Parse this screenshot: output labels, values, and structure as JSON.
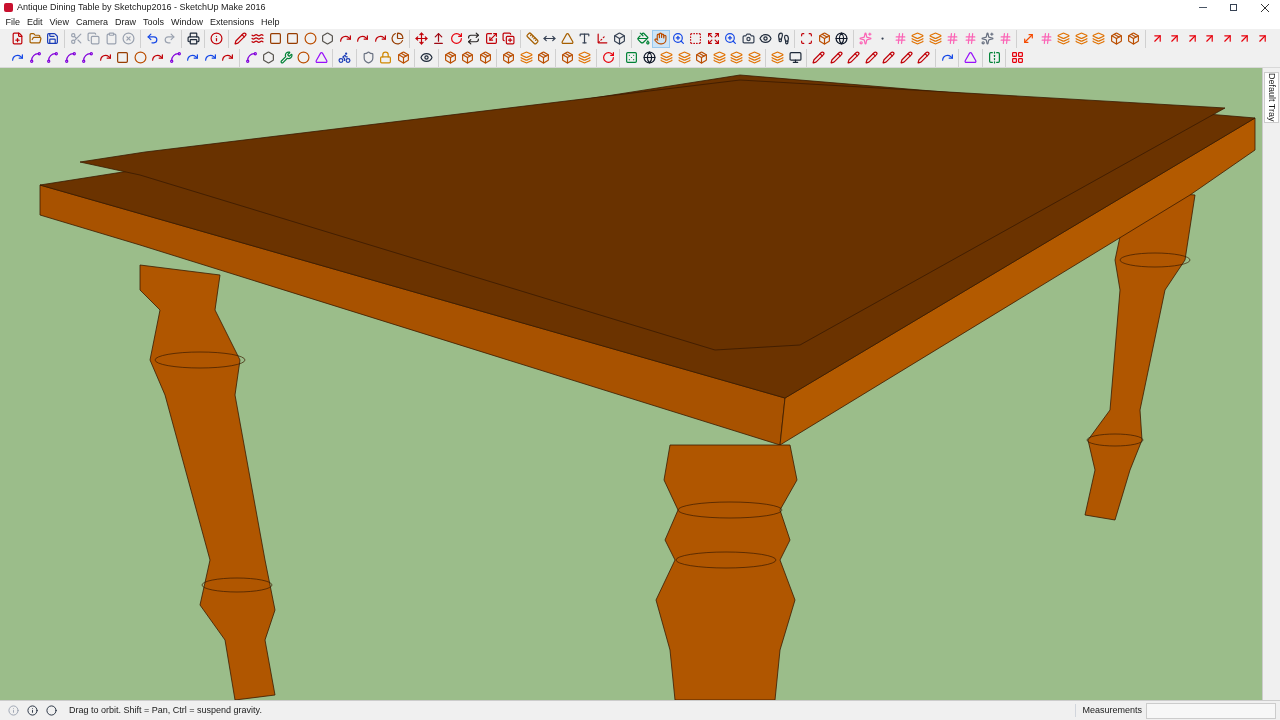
{
  "window": {
    "title": "Antique Dining Table by Sketchup2016 - SketchUp Make 2016"
  },
  "menu": [
    "File",
    "Edit",
    "View",
    "Camera",
    "Draw",
    "Tools",
    "Window",
    "Extensions",
    "Help"
  ],
  "toolbar_rows": [
    {
      "groups": [
        [
          {
            "kind": "new",
            "selected": false
          },
          {
            "kind": "open",
            "selected": false
          },
          {
            "kind": "save",
            "selected": false
          }
        ],
        [
          {
            "kind": "cut",
            "selected": false
          },
          {
            "kind": "copy",
            "selected": false
          },
          {
            "kind": "paste",
            "selected": false
          },
          {
            "kind": "erase",
            "selected": false
          }
        ],
        [
          {
            "kind": "undo",
            "selected": false
          },
          {
            "kind": "redo",
            "selected": false
          }
        ],
        [
          {
            "kind": "print",
            "selected": false
          }
        ],
        [
          {
            "kind": "info",
            "selected": false
          }
        ],
        [
          {
            "kind": "pencil",
            "selected": false
          },
          {
            "kind": "freehand",
            "selected": false
          },
          {
            "kind": "rectangle",
            "selected": false
          },
          {
            "kind": "rectangle",
            "selected": false
          },
          {
            "kind": "circle",
            "selected": false
          },
          {
            "kind": "polygon",
            "selected": false
          },
          {
            "kind": "arc",
            "selected": false
          },
          {
            "kind": "arc",
            "selected": false
          },
          {
            "kind": "arc",
            "selected": false
          },
          {
            "kind": "pie",
            "selected": false
          }
        ],
        [
          {
            "kind": "move",
            "selected": false
          },
          {
            "kind": "pushpull",
            "selected": false
          },
          {
            "kind": "rotate",
            "selected": false
          },
          {
            "kind": "followme",
            "selected": false
          },
          {
            "kind": "scale",
            "selected": false
          },
          {
            "kind": "offset",
            "selected": false
          }
        ],
        [
          {
            "kind": "tape",
            "selected": false
          },
          {
            "kind": "dimension",
            "selected": false
          },
          {
            "kind": "protractor",
            "selected": false
          },
          {
            "kind": "text",
            "selected": false
          },
          {
            "kind": "axes",
            "selected": false
          },
          {
            "kind": "text3d",
            "selected": false
          }
        ],
        [
          {
            "kind": "paint",
            "selected": false
          },
          {
            "kind": "orbit",
            "selected": true
          },
          {
            "kind": "zoom",
            "selected": false
          },
          {
            "kind": "zoomwindow",
            "selected": false
          },
          {
            "kind": "extents",
            "selected": false
          },
          {
            "kind": "zoom",
            "selected": false
          },
          {
            "kind": "camera",
            "selected": false
          },
          {
            "kind": "eye",
            "selected": false
          },
          {
            "kind": "walk",
            "selected": false
          }
        ],
        [
          {
            "kind": "section",
            "selected": false
          },
          {
            "kind": "component",
            "selected": false
          },
          {
            "kind": "sphere",
            "selected": false
          }
        ],
        [
          {
            "kind": "point",
            "selected": false
          },
          {
            "kind": "dot",
            "selected": false
          },
          {
            "kind": "grid",
            "selected": false
          },
          {
            "kind": "layer",
            "selected": false
          },
          {
            "kind": "layer",
            "selected": false
          },
          {
            "kind": "grid",
            "selected": false
          },
          {
            "kind": "grid",
            "selected": false
          },
          {
            "kind": "star",
            "selected": false
          },
          {
            "kind": "grid",
            "selected": false
          }
        ],
        [
          {
            "kind": "guide",
            "selected": false
          },
          {
            "kind": "grid",
            "selected": false
          },
          {
            "kind": "layer",
            "selected": false
          },
          {
            "kind": "layer",
            "selected": false
          },
          {
            "kind": "layer",
            "selected": false
          },
          {
            "kind": "component",
            "selected": false
          },
          {
            "kind": "component",
            "selected": false
          }
        ],
        [
          {
            "kind": "export",
            "selected": false
          },
          {
            "kind": "export",
            "selected": false
          },
          {
            "kind": "export",
            "selected": false
          },
          {
            "kind": "export",
            "selected": false
          },
          {
            "kind": "export",
            "selected": false
          },
          {
            "kind": "export",
            "selected": false
          },
          {
            "kind": "export",
            "selected": false
          }
        ]
      ]
    },
    {
      "groups": [
        [
          {
            "kind": "curve",
            "selected": false
          },
          {
            "kind": "spline",
            "selected": false
          },
          {
            "kind": "spline",
            "selected": false
          },
          {
            "kind": "spline",
            "selected": false
          },
          {
            "kind": "spline",
            "selected": false
          },
          {
            "kind": "arc",
            "selected": false
          },
          {
            "kind": "rectangle",
            "selected": false
          },
          {
            "kind": "circle",
            "selected": false
          },
          {
            "kind": "arc",
            "selected": false
          },
          {
            "kind": "spline",
            "selected": false
          },
          {
            "kind": "curve",
            "selected": false
          },
          {
            "kind": "curve",
            "selected": false
          },
          {
            "kind": "arc",
            "selected": false
          }
        ],
        [
          {
            "kind": "spline",
            "selected": false
          },
          {
            "kind": "polygon",
            "selected": false
          },
          {
            "kind": "wrench",
            "selected": false
          },
          {
            "kind": "circle",
            "selected": false
          },
          {
            "kind": "triangle",
            "selected": false
          }
        ],
        [
          {
            "kind": "bike",
            "selected": false
          }
        ],
        [
          {
            "kind": "shield",
            "selected": false
          },
          {
            "kind": "lock",
            "selected": false
          },
          {
            "kind": "component",
            "selected": false
          }
        ],
        [
          {
            "kind": "eye",
            "selected": false
          }
        ],
        [
          {
            "kind": "component",
            "selected": false
          },
          {
            "kind": "component",
            "selected": false
          },
          {
            "kind": "component",
            "selected": false
          }
        ],
        [
          {
            "kind": "component",
            "selected": false
          },
          {
            "kind": "layer",
            "selected": false
          },
          {
            "kind": "component",
            "selected": false
          }
        ],
        [
          {
            "kind": "component",
            "selected": false
          },
          {
            "kind": "layer",
            "selected": false
          }
        ],
        [
          {
            "kind": "rotate",
            "selected": false
          }
        ],
        [
          {
            "kind": "dice",
            "selected": false
          },
          {
            "kind": "sphere",
            "selected": false
          },
          {
            "kind": "layer",
            "selected": false
          },
          {
            "kind": "layer",
            "selected": false
          },
          {
            "kind": "component",
            "selected": false
          },
          {
            "kind": "layer",
            "selected": false
          },
          {
            "kind": "layer",
            "selected": false
          },
          {
            "kind": "layer",
            "selected": false
          }
        ],
        [
          {
            "kind": "layer",
            "selected": false
          },
          {
            "kind": "monitor",
            "selected": false
          }
        ],
        [
          {
            "kind": "pencil",
            "selected": false
          },
          {
            "kind": "pencil",
            "selected": false
          },
          {
            "kind": "pencil",
            "selected": false
          },
          {
            "kind": "pencil",
            "selected": false
          },
          {
            "kind": "pencil",
            "selected": false
          },
          {
            "kind": "pencil",
            "selected": false
          },
          {
            "kind": "pencil",
            "selected": false
          }
        ],
        [
          {
            "kind": "curve",
            "selected": false
          }
        ],
        [
          {
            "kind": "triangle",
            "selected": false
          }
        ],
        [
          {
            "kind": "mirror",
            "selected": false
          }
        ],
        [
          {
            "kind": "tray",
            "selected": false
          }
        ]
      ]
    }
  ],
  "tray_tab": {
    "label": "Default Tray"
  },
  "status_bar": {
    "message": "Drag to orbit. Shift = Pan, Ctrl = suspend gravity.",
    "measurements_label": "Measurements"
  }
}
